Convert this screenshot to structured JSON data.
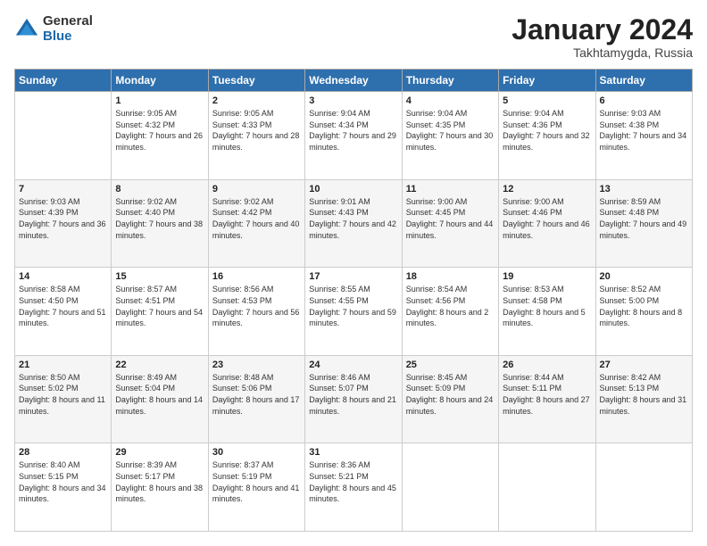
{
  "header": {
    "logo_general": "General",
    "logo_blue": "Blue",
    "month_title": "January 2024",
    "location": "Takhtamygda, Russia"
  },
  "weekdays": [
    "Sunday",
    "Monday",
    "Tuesday",
    "Wednesday",
    "Thursday",
    "Friday",
    "Saturday"
  ],
  "weeks": [
    [
      {
        "day": "",
        "sunrise": "",
        "sunset": "",
        "daylight": ""
      },
      {
        "day": "1",
        "sunrise": "9:05 AM",
        "sunset": "4:32 PM",
        "daylight": "7 hours and 26 minutes."
      },
      {
        "day": "2",
        "sunrise": "9:05 AM",
        "sunset": "4:33 PM",
        "daylight": "7 hours and 28 minutes."
      },
      {
        "day": "3",
        "sunrise": "9:04 AM",
        "sunset": "4:34 PM",
        "daylight": "7 hours and 29 minutes."
      },
      {
        "day": "4",
        "sunrise": "9:04 AM",
        "sunset": "4:35 PM",
        "daylight": "7 hours and 30 minutes."
      },
      {
        "day": "5",
        "sunrise": "9:04 AM",
        "sunset": "4:36 PM",
        "daylight": "7 hours and 32 minutes."
      },
      {
        "day": "6",
        "sunrise": "9:03 AM",
        "sunset": "4:38 PM",
        "daylight": "7 hours and 34 minutes."
      }
    ],
    [
      {
        "day": "7",
        "sunrise": "9:03 AM",
        "sunset": "4:39 PM",
        "daylight": "7 hours and 36 minutes."
      },
      {
        "day": "8",
        "sunrise": "9:02 AM",
        "sunset": "4:40 PM",
        "daylight": "7 hours and 38 minutes."
      },
      {
        "day": "9",
        "sunrise": "9:02 AM",
        "sunset": "4:42 PM",
        "daylight": "7 hours and 40 minutes."
      },
      {
        "day": "10",
        "sunrise": "9:01 AM",
        "sunset": "4:43 PM",
        "daylight": "7 hours and 42 minutes."
      },
      {
        "day": "11",
        "sunrise": "9:00 AM",
        "sunset": "4:45 PM",
        "daylight": "7 hours and 44 minutes."
      },
      {
        "day": "12",
        "sunrise": "9:00 AM",
        "sunset": "4:46 PM",
        "daylight": "7 hours and 46 minutes."
      },
      {
        "day": "13",
        "sunrise": "8:59 AM",
        "sunset": "4:48 PM",
        "daylight": "7 hours and 49 minutes."
      }
    ],
    [
      {
        "day": "14",
        "sunrise": "8:58 AM",
        "sunset": "4:50 PM",
        "daylight": "7 hours and 51 minutes."
      },
      {
        "day": "15",
        "sunrise": "8:57 AM",
        "sunset": "4:51 PM",
        "daylight": "7 hours and 54 minutes."
      },
      {
        "day": "16",
        "sunrise": "8:56 AM",
        "sunset": "4:53 PM",
        "daylight": "7 hours and 56 minutes."
      },
      {
        "day": "17",
        "sunrise": "8:55 AM",
        "sunset": "4:55 PM",
        "daylight": "7 hours and 59 minutes."
      },
      {
        "day": "18",
        "sunrise": "8:54 AM",
        "sunset": "4:56 PM",
        "daylight": "8 hours and 2 minutes."
      },
      {
        "day": "19",
        "sunrise": "8:53 AM",
        "sunset": "4:58 PM",
        "daylight": "8 hours and 5 minutes."
      },
      {
        "day": "20",
        "sunrise": "8:52 AM",
        "sunset": "5:00 PM",
        "daylight": "8 hours and 8 minutes."
      }
    ],
    [
      {
        "day": "21",
        "sunrise": "8:50 AM",
        "sunset": "5:02 PM",
        "daylight": "8 hours and 11 minutes."
      },
      {
        "day": "22",
        "sunrise": "8:49 AM",
        "sunset": "5:04 PM",
        "daylight": "8 hours and 14 minutes."
      },
      {
        "day": "23",
        "sunrise": "8:48 AM",
        "sunset": "5:06 PM",
        "daylight": "8 hours and 17 minutes."
      },
      {
        "day": "24",
        "sunrise": "8:46 AM",
        "sunset": "5:07 PM",
        "daylight": "8 hours and 21 minutes."
      },
      {
        "day": "25",
        "sunrise": "8:45 AM",
        "sunset": "5:09 PM",
        "daylight": "8 hours and 24 minutes."
      },
      {
        "day": "26",
        "sunrise": "8:44 AM",
        "sunset": "5:11 PM",
        "daylight": "8 hours and 27 minutes."
      },
      {
        "day": "27",
        "sunrise": "8:42 AM",
        "sunset": "5:13 PM",
        "daylight": "8 hours and 31 minutes."
      }
    ],
    [
      {
        "day": "28",
        "sunrise": "8:40 AM",
        "sunset": "5:15 PM",
        "daylight": "8 hours and 34 minutes."
      },
      {
        "day": "29",
        "sunrise": "8:39 AM",
        "sunset": "5:17 PM",
        "daylight": "8 hours and 38 minutes."
      },
      {
        "day": "30",
        "sunrise": "8:37 AM",
        "sunset": "5:19 PM",
        "daylight": "8 hours and 41 minutes."
      },
      {
        "day": "31",
        "sunrise": "8:36 AM",
        "sunset": "5:21 PM",
        "daylight": "8 hours and 45 minutes."
      },
      {
        "day": "",
        "sunrise": "",
        "sunset": "",
        "daylight": ""
      },
      {
        "day": "",
        "sunrise": "",
        "sunset": "",
        "daylight": ""
      },
      {
        "day": "",
        "sunrise": "",
        "sunset": "",
        "daylight": ""
      }
    ]
  ]
}
